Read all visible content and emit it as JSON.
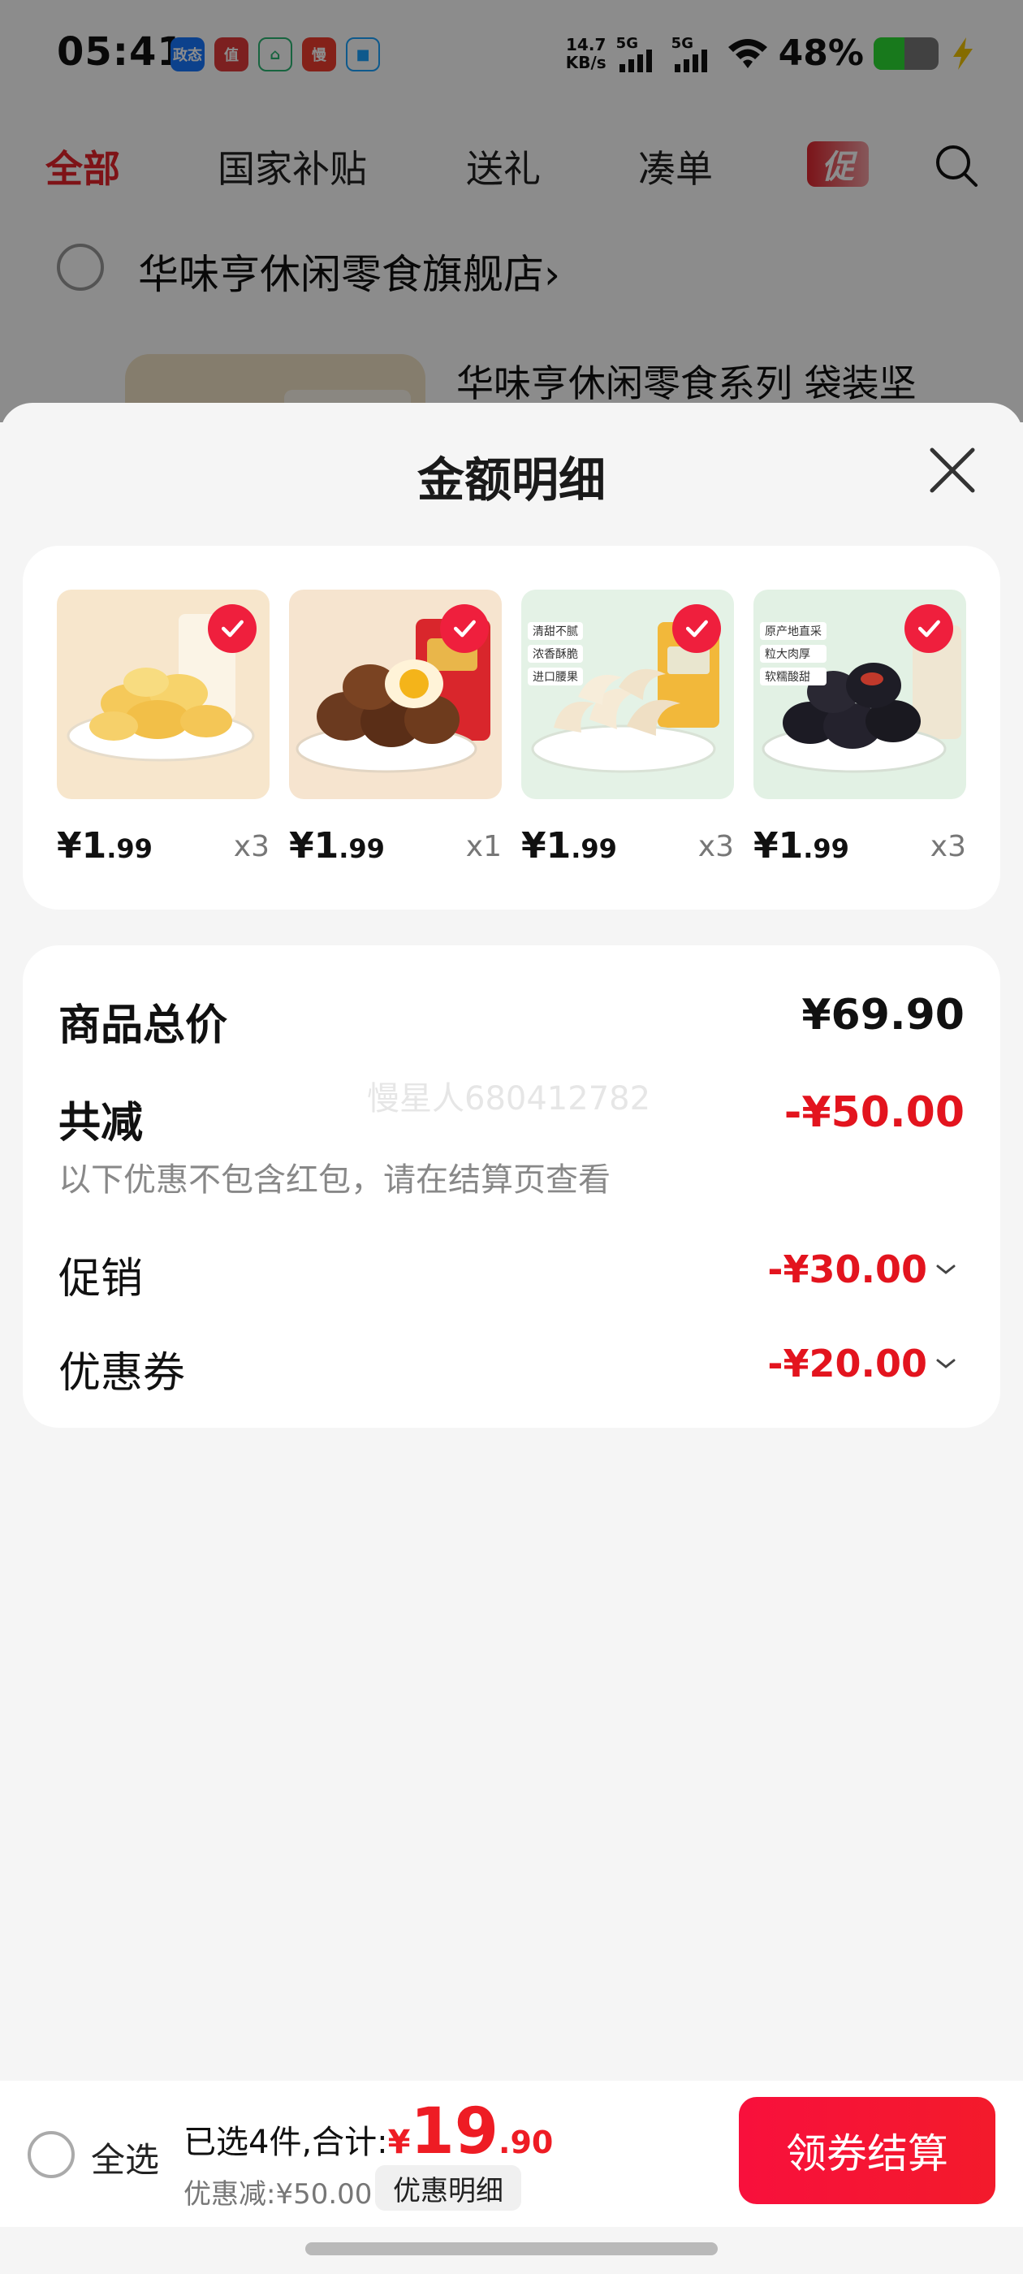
{
  "status_bar": {
    "time": "05:41",
    "app_icons": [
      {
        "name": "alipay-icon",
        "text": "政态",
        "color": "#1677ff"
      },
      {
        "name": "zhi-icon",
        "text": "值",
        "color": "#e23b3b"
      },
      {
        "name": "home-app-icon",
        "text": "⌂",
        "color": "#2bb673"
      },
      {
        "name": "man-icon",
        "text": "慢",
        "color": "#f03d2f"
      },
      {
        "name": "square-app-icon",
        "text": "■",
        "color": "#1aa3ff"
      }
    ],
    "net_speed": "14.7",
    "net_speed_unit": "KB/s",
    "sim1": "5G",
    "sim2": "5G",
    "battery_pct_text": "48%",
    "battery_level": 0.48
  },
  "top_tabs": [
    {
      "label": "全部",
      "active": true
    },
    {
      "label": "国家补贴",
      "active": false
    },
    {
      "label": "送礼",
      "active": false
    },
    {
      "label": "凑单",
      "active": false
    }
  ],
  "promo_tag": "促",
  "store": {
    "name": "华味亨休闲零食旗舰店",
    "chevron": "›",
    "product_title": "华味亨休闲零食系列 袋装坚"
  },
  "sheet": {
    "title": "金额明细",
    "items": [
      {
        "price_int": "¥1",
        "price_dec": ".99",
        "qty": "x3",
        "kind": "banana"
      },
      {
        "price_int": "¥1",
        "price_dec": ".99",
        "qty": "x1",
        "kind": "egg"
      },
      {
        "price_int": "¥1",
        "price_dec": ".99",
        "qty": "x3",
        "kind": "cashew"
      },
      {
        "price_int": "¥1",
        "price_dec": ".99",
        "qty": "x3",
        "kind": "plum"
      }
    ],
    "item_tags": {
      "cashew": [
        "清甜不腻",
        "浓香酥脆",
        "进口腰果"
      ],
      "plum": [
        "原产地直采",
        "粒大肉厚",
        "软糯酸甜"
      ]
    },
    "summary": {
      "total_label": "商品总价",
      "total_value": "¥69.90",
      "reduce_label": "共减",
      "reduce_value": "-¥50.00",
      "note": "以下优惠不包含红包，请在结算页查看",
      "promo_label": "促销",
      "promo_value": "-¥30.00",
      "coupon_label": "优惠券",
      "coupon_value": "-¥20.00",
      "watermark": "慢星人680412782"
    }
  },
  "bottom_bar": {
    "select_all": "全选",
    "total_prefix": "已选4件,合计:",
    "currency": "¥",
    "total_int": "19",
    "total_dec": ".90",
    "discount_text": "优惠减:¥50.00",
    "detail_button": "优惠明细",
    "checkout_button": "领券结算"
  },
  "colors": {
    "accent_red": "#e3141e",
    "checkout_red": "#f8103c",
    "active_tab": "#e5232b"
  }
}
